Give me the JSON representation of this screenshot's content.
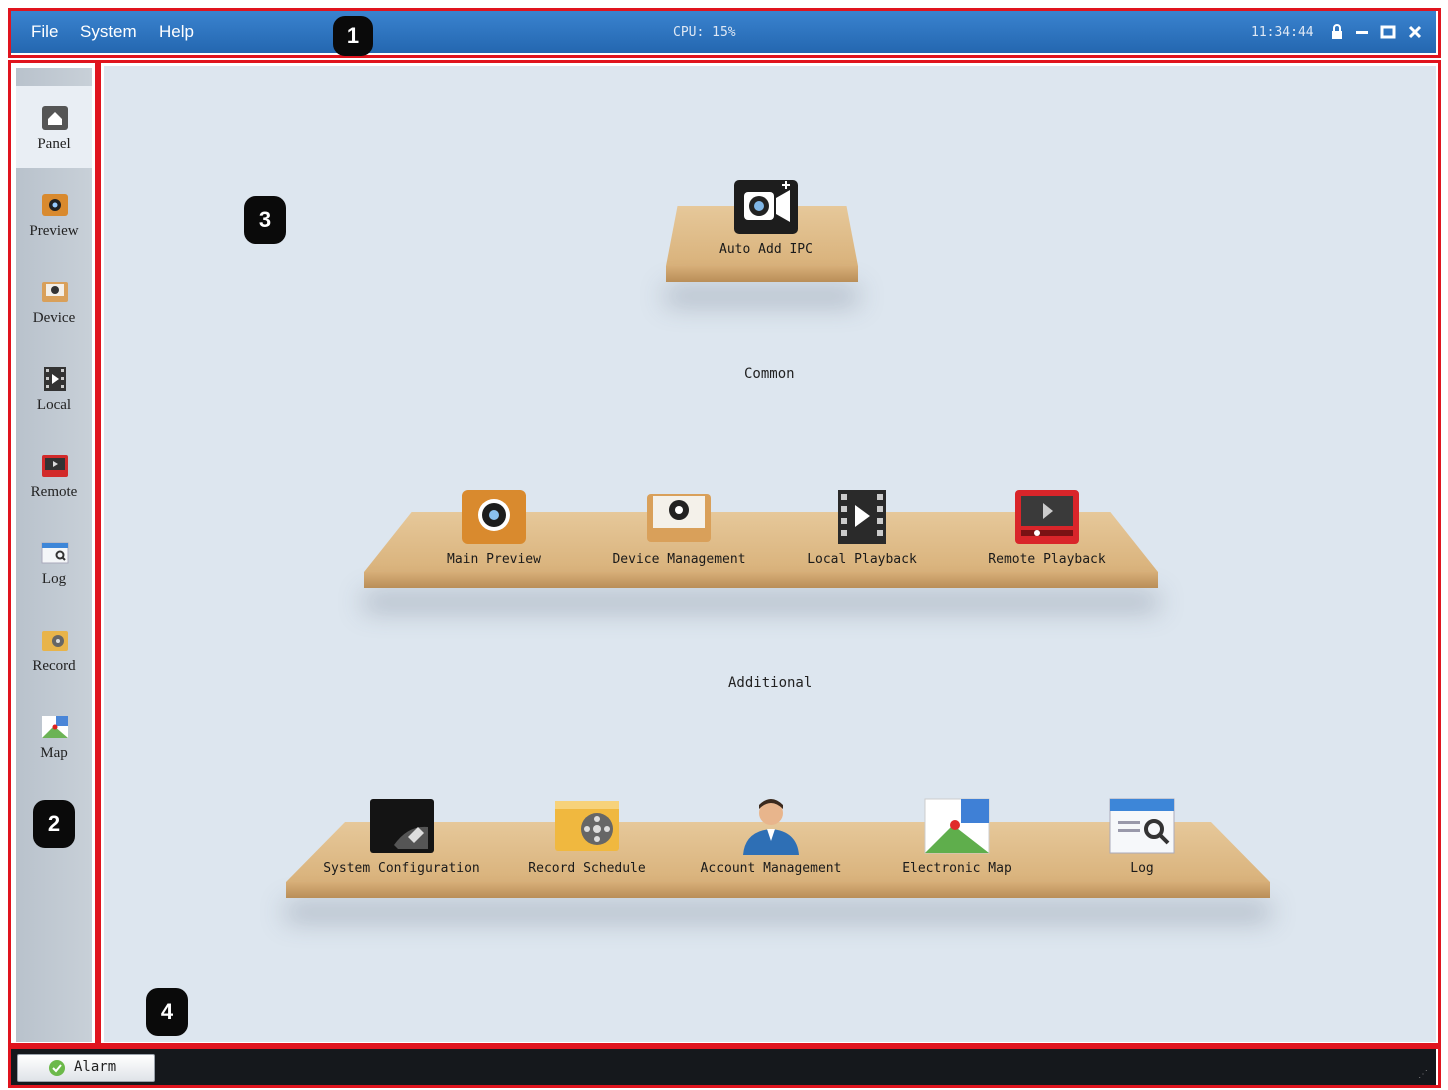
{
  "menu": {
    "file": "File",
    "system": "System",
    "help": "Help"
  },
  "cpu": "CPU: 15%",
  "clock": "11:34:44",
  "callouts": {
    "c1": "1",
    "c2": "2",
    "c3": "3",
    "c4": "4"
  },
  "sidebar": {
    "items": [
      {
        "label": "Panel",
        "icon": "home-icon"
      },
      {
        "label": "Preview",
        "icon": "preview-icon"
      },
      {
        "label": "Device",
        "icon": "device-icon"
      },
      {
        "label": "Local",
        "icon": "film-icon"
      },
      {
        "label": "Remote",
        "icon": "remote-playback-icon"
      },
      {
        "label": "Log",
        "icon": "log-icon"
      },
      {
        "label": "Record",
        "icon": "record-icon"
      },
      {
        "label": "Map",
        "icon": "map-icon"
      }
    ]
  },
  "panel": {
    "top_shelf": [
      {
        "label": "Auto Add IPC",
        "icon": "camera-add-icon"
      }
    ],
    "common_label": "Common",
    "common": [
      {
        "label": "Main Preview",
        "icon": "main-preview-icon"
      },
      {
        "label": "Device Management",
        "icon": "device-management-icon"
      },
      {
        "label": "Local Playback",
        "icon": "local-playback-icon"
      },
      {
        "label": "Remote Playback",
        "icon": "remote-playback-icon"
      }
    ],
    "additional_label": "Additional",
    "additional": [
      {
        "label": "System Configuration",
        "icon": "system-config-icon"
      },
      {
        "label": "Record Schedule",
        "icon": "record-schedule-icon"
      },
      {
        "label": "Account Management",
        "icon": "account-icon"
      },
      {
        "label": "Electronic Map",
        "icon": "electronic-map-icon"
      },
      {
        "label": "Log",
        "icon": "log-icon"
      }
    ]
  },
  "status": {
    "alarm_label": "Alarm"
  },
  "colors": {
    "titlebar": "#2d74bf",
    "callout_frame": "#e0141e",
    "main_bg": "#dde6ef",
    "sidebar_bg": "#c0c8d0",
    "statusbar": "#15181c"
  }
}
